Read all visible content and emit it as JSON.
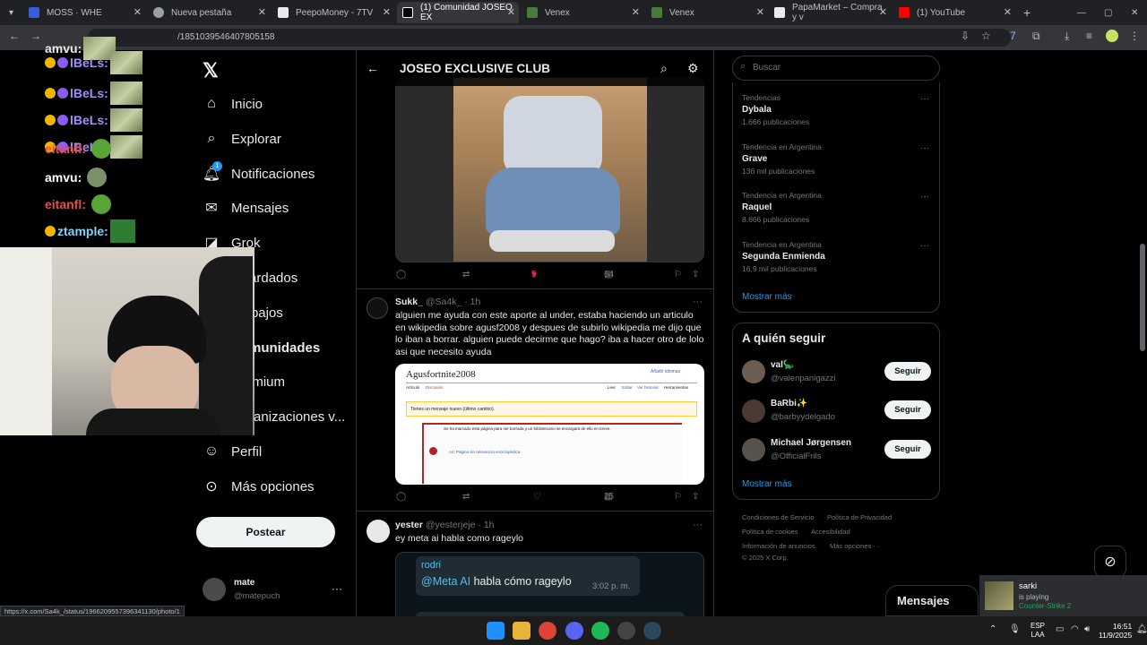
{
  "browser": {
    "tabs": [
      {
        "label": "MOSS · WHE"
      },
      {
        "label": "Nueva pestaña"
      },
      {
        "label": "PeepoMoney - 7TV"
      },
      {
        "label": "(1) Comunidad JOSEO EX"
      },
      {
        "label": "Venex"
      },
      {
        "label": "Venex"
      },
      {
        "label": "PapaMarket – Compra y v"
      },
      {
        "label": "(1) YouTube"
      }
    ],
    "url": "/1851039546407805158",
    "status_url": "https://x.com/Sa4k_/status/1966209557396341130/photo/1"
  },
  "stream_chat": [
    {
      "user": "amvu:"
    },
    {
      "user": "lBeLs:"
    },
    {
      "user": "lBeLs:"
    },
    {
      "user": "lBeLs:"
    },
    {
      "user": "lBeLs:"
    },
    {
      "user": "eitanfl:"
    },
    {
      "user": "amvu:"
    },
    {
      "user": "eitanfl:"
    },
    {
      "user": "ztample:"
    }
  ],
  "nav": {
    "items": [
      "Inicio",
      "Explorar",
      "Notificaciones",
      "Mensajes",
      "Grok",
      "Guardados",
      "Trabajos",
      "Comunidades",
      "Premium",
      "Organizaciones v...",
      "Perfil",
      "Más opciones"
    ],
    "notif_count": "1",
    "post_label": "Postear",
    "account_name": "mate",
    "account_handle": "@matepuch"
  },
  "timeline": {
    "title": "JOSEO EXCLUSIVE CLUB",
    "tweet0": {
      "likes": "5",
      "views": "64"
    },
    "tweet1": {
      "name": "Sukk_",
      "handle": "@Sa4k_",
      "time": "· 1h",
      "text": "alguien me ayuda con este aporte al under, estaba haciendo un articulo en wikipedia sobre agusf2008 y despues de subirlo wikipedia me dijo que lo iban a borrar. alguien puede decirme que hago? iba a hacer otro de lolo asi que necesito ayuda",
      "wiki_title": "Agusfortnite2008",
      "wiki_tabs": [
        "Artículo",
        "Discusión"
      ],
      "wiki_actions": [
        "Leer",
        "Editar",
        "Ver historial",
        "Herramientas"
      ],
      "wiki_lang": "Añadir idiomas",
      "wiki_notice": "Tienes un mensaje nuevo (último cambio).",
      "wiki_del_text": "Se ha marcado esta página para ser borrada y un bibliotecario se encargará de ello en breve.",
      "wiki_a4": "A4: Página sin relevancia enciclopédica.",
      "views": "25"
    },
    "tweet2": {
      "name": "yester",
      "handle": "@yesterjeje",
      "time": "· 1h",
      "text": "ey meta ai habla como rageylo",
      "chat_sender": "rodri",
      "chat_mention": "@Meta AI",
      "chat_msg": "habla cómo rageylo",
      "chat_time": "3:02 p. m."
    }
  },
  "sidebar": {
    "search_placeholder": "Buscar",
    "trends": [
      {
        "context": "Tendencias",
        "name": "Dybala",
        "count": "1.666 publicaciones"
      },
      {
        "context": "Tendencia en Argentina",
        "name": "Grave",
        "count": "136 mil publicaciones"
      },
      {
        "context": "Tendencia en Argentina",
        "name": "Raquel",
        "count": "8.666 publicaciones"
      },
      {
        "context": "Tendencia en Argentina",
        "name": "Segunda Enmienda",
        "count": "16,9 mil publicaciones"
      }
    ],
    "show_more": "Mostrar más",
    "who_to_follow": "A quién seguir",
    "follow": [
      {
        "name": "val🦕",
        "handle": "@valenpanigazzi"
      },
      {
        "name": "BaRbi✨",
        "handle": "@barbyydelgado"
      },
      {
        "name": "Michael Jørgensen",
        "handle": "@OfficialFrils"
      }
    ],
    "follow_label": "Seguir",
    "footer": [
      "Condiciones de Servicio",
      "Política de Privacidad",
      "Política de cookies",
      "Accesibilidad",
      "Información de anuncios",
      "Más opciones ···",
      "© 2025 X Corp."
    ]
  },
  "messages_drawer": "Mensajes",
  "discord_popup": {
    "name": "sarki",
    "status": "is playing",
    "game": "Counter-Strike 2"
  },
  "taskbar": {
    "lang": "ESP",
    "lang2": "LAA",
    "time": "16:51",
    "date": "11/9/2025"
  }
}
